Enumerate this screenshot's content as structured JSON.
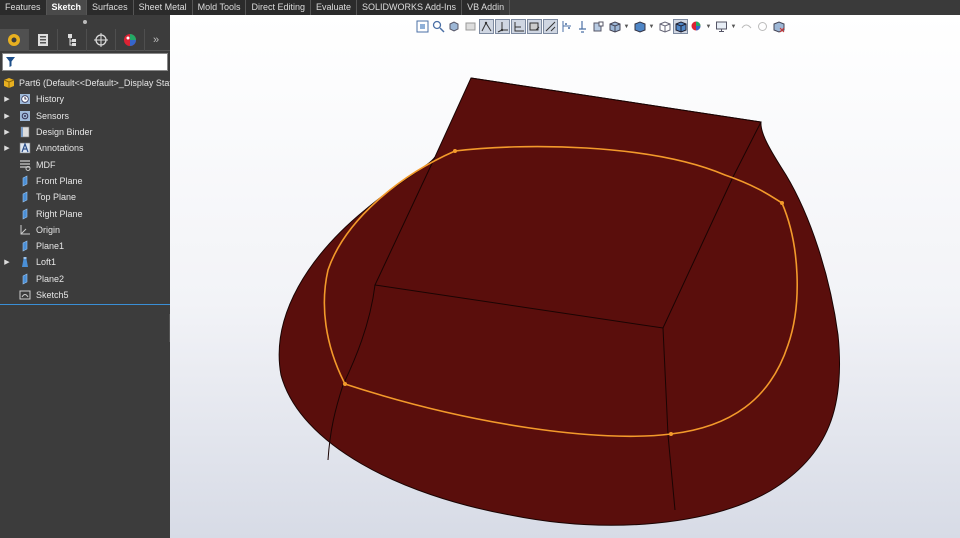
{
  "command_tabs": [
    {
      "label": "Features",
      "active": false
    },
    {
      "label": "Sketch",
      "active": true
    },
    {
      "label": "Surfaces",
      "active": false
    },
    {
      "label": "Sheet Metal",
      "active": false
    },
    {
      "label": "Mold Tools",
      "active": false
    },
    {
      "label": "Direct Editing",
      "active": false
    },
    {
      "label": "Evaluate",
      "active": false
    },
    {
      "label": "SOLIDWORKS Add-Ins",
      "active": false
    },
    {
      "label": "VB Addin",
      "active": false
    }
  ],
  "manager_tabs": [
    "feature-manager-icon",
    "property-manager-icon",
    "configuration-manager-icon",
    "dimxpert-manager-icon",
    "display-manager-icon"
  ],
  "feature_tree": {
    "root": "Part6  (Default<<Default>_Display Stat",
    "items": [
      {
        "label": "History",
        "icon": "history-icon",
        "expandable": true
      },
      {
        "label": "Sensors",
        "icon": "sensors-icon",
        "expandable": true
      },
      {
        "label": "Design Binder",
        "icon": "design-binder-icon",
        "expandable": true
      },
      {
        "label": "Annotations",
        "icon": "annotations-icon",
        "expandable": true
      },
      {
        "label": "MDF",
        "icon": "material-icon",
        "expandable": false
      },
      {
        "label": "Front Plane",
        "icon": "plane-icon",
        "expandable": false
      },
      {
        "label": "Top Plane",
        "icon": "plane-icon",
        "expandable": false
      },
      {
        "label": "Right Plane",
        "icon": "plane-icon",
        "expandable": false
      },
      {
        "label": "Origin",
        "icon": "origin-icon",
        "expandable": false
      },
      {
        "label": "Plane1",
        "icon": "plane-icon",
        "expandable": false
      },
      {
        "label": "Loft1",
        "icon": "loft-icon",
        "expandable": true
      },
      {
        "label": "Plane2",
        "icon": "plane-icon",
        "expandable": false
      },
      {
        "label": "Sketch5",
        "icon": "sketch-icon",
        "expandable": false
      }
    ]
  },
  "colors": {
    "model_fill": "#5a0e0c",
    "sketch_curve": "#f39a2b",
    "selection_line": "#3a8fd6"
  }
}
